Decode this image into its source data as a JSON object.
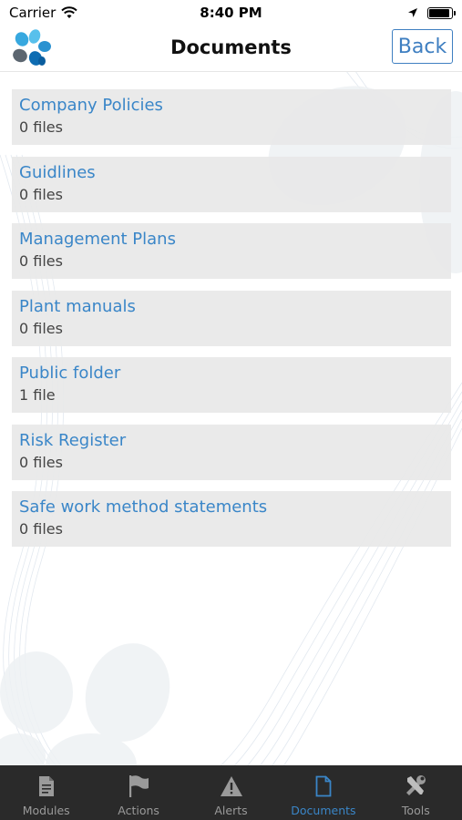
{
  "status_bar": {
    "carrier": "Carrier",
    "time": "8:40 PM"
  },
  "nav": {
    "title": "Documents",
    "back_label": "Back"
  },
  "folders": [
    {
      "name": "Company Policies",
      "count": "0 files"
    },
    {
      "name": "Guidlines",
      "count": "0 files"
    },
    {
      "name": "Management Plans",
      "count": "0 files"
    },
    {
      "name": "Plant manuals",
      "count": "0 files"
    },
    {
      "name": "Public folder",
      "count": "1 file"
    },
    {
      "name": "Risk Register",
      "count": "0 files"
    },
    {
      "name": "Safe work method statements",
      "count": "0 files"
    }
  ],
  "tabs": [
    {
      "label": "Modules",
      "icon": "document-icon"
    },
    {
      "label": "Actions",
      "icon": "flag-icon"
    },
    {
      "label": "Alerts",
      "icon": "warning-icon"
    },
    {
      "label": "Documents",
      "icon": "file-outline-icon",
      "active": true
    },
    {
      "label": "Tools",
      "icon": "tools-icon"
    }
  ],
  "colors": {
    "accent": "#3a86c8",
    "tab_bar": "#2a2a2a",
    "list_item_bg": "#e8e8e8"
  }
}
